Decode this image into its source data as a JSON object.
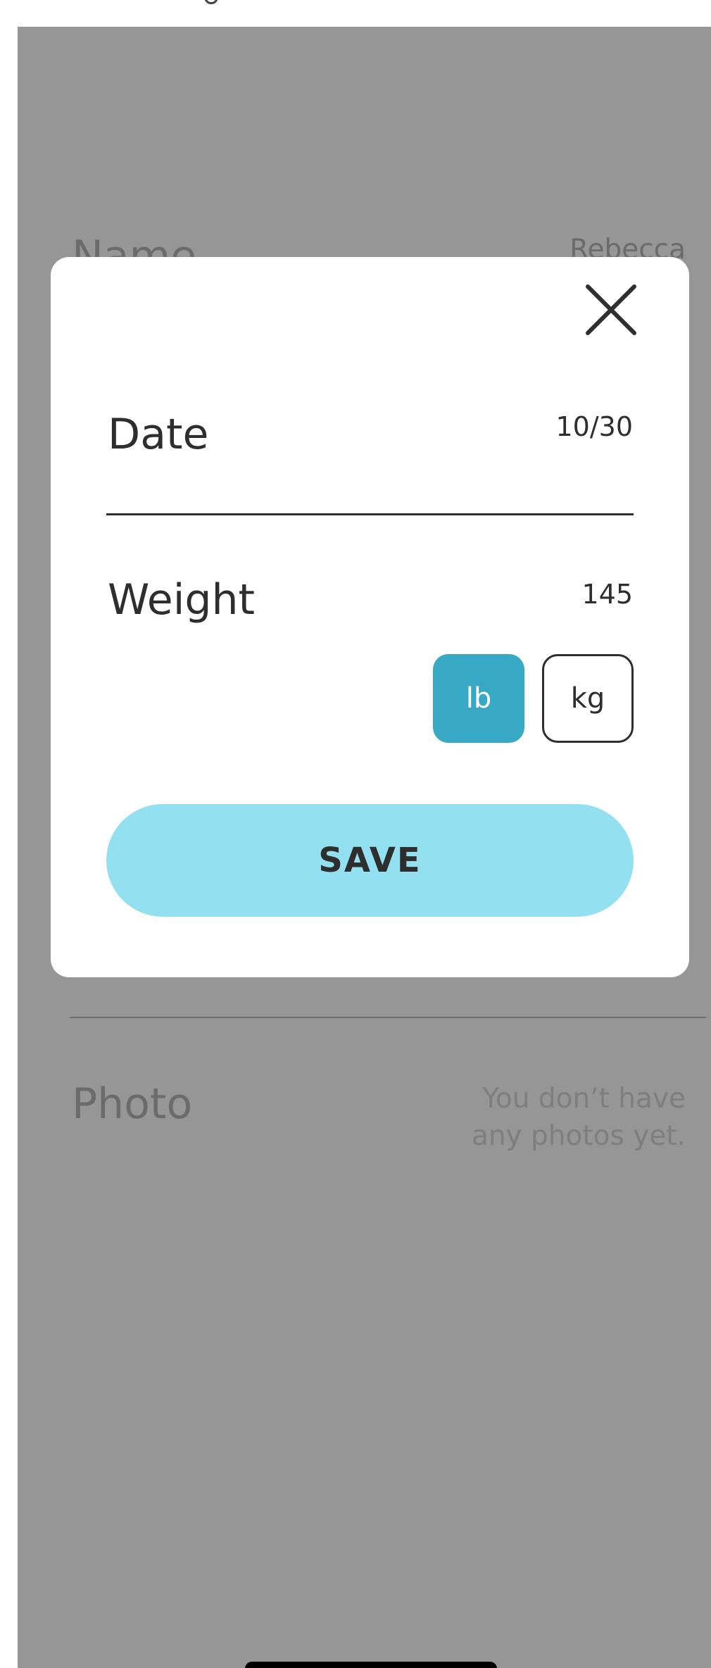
{
  "background": {
    "name_label": "Name",
    "name_value": "Rebecca",
    "photo_label": "Photo",
    "photo_empty_text": "You don’t have any photos yet."
  },
  "modal": {
    "close_icon": "close-x-icon",
    "date_label": "Date",
    "date_value": "10/30",
    "weight_label": "Weight",
    "weight_value": "145",
    "units": [
      {
        "label": "lb",
        "selected": true
      },
      {
        "label": "kg",
        "selected": false
      }
    ],
    "save_label": "SAVE"
  },
  "colors": {
    "overlay": "#969696",
    "unit_selected": "#38a9c4",
    "save_button": "#93e0f0",
    "text_dark": "#2e2e2e"
  }
}
